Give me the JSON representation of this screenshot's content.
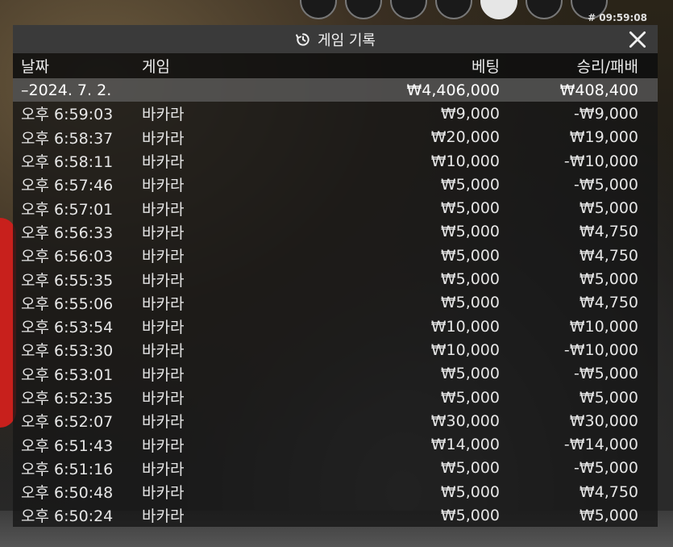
{
  "round_id": "# 09:59:08",
  "panel": {
    "title": "게임 기록",
    "columns": {
      "date": "날짜",
      "game": "게임",
      "bet": "베팅",
      "win_loss": "승리/패배"
    }
  },
  "summary": {
    "date": "–2024. 7. 2.",
    "bet": "₩4,406,000",
    "win_loss": "₩408,400"
  },
  "rows": [
    {
      "time": "오후 6:59:03",
      "game": "바카라",
      "bet": "₩9,000",
      "result": "-₩9,000"
    },
    {
      "time": "오후 6:58:37",
      "game": "바카라",
      "bet": "₩20,000",
      "result": "₩19,000"
    },
    {
      "time": "오후 6:58:11",
      "game": "바카라",
      "bet": "₩10,000",
      "result": "-₩10,000"
    },
    {
      "time": "오후 6:57:46",
      "game": "바카라",
      "bet": "₩5,000",
      "result": "-₩5,000"
    },
    {
      "time": "오후 6:57:01",
      "game": "바카라",
      "bet": "₩5,000",
      "result": "₩5,000"
    },
    {
      "time": "오후 6:56:33",
      "game": "바카라",
      "bet": "₩5,000",
      "result": "₩4,750"
    },
    {
      "time": "오후 6:56:03",
      "game": "바카라",
      "bet": "₩5,000",
      "result": "₩4,750"
    },
    {
      "time": "오후 6:55:35",
      "game": "바카라",
      "bet": "₩5,000",
      "result": "₩5,000"
    },
    {
      "time": "오후 6:55:06",
      "game": "바카라",
      "bet": "₩5,000",
      "result": "₩4,750"
    },
    {
      "time": "오후 6:53:54",
      "game": "바카라",
      "bet": "₩10,000",
      "result": "₩10,000"
    },
    {
      "time": "오후 6:53:30",
      "game": "바카라",
      "bet": "₩10,000",
      "result": "-₩10,000"
    },
    {
      "time": "오후 6:53:01",
      "game": "바카라",
      "bet": "₩5,000",
      "result": "-₩5,000"
    },
    {
      "time": "오후 6:52:35",
      "game": "바카라",
      "bet": "₩5,000",
      "result": "₩5,000"
    },
    {
      "time": "오후 6:52:07",
      "game": "바카라",
      "bet": "₩30,000",
      "result": "₩30,000"
    },
    {
      "time": "오후 6:51:43",
      "game": "바카라",
      "bet": "₩14,000",
      "result": "-₩14,000"
    },
    {
      "time": "오후 6:51:16",
      "game": "바카라",
      "bet": "₩5,000",
      "result": "-₩5,000"
    },
    {
      "time": "오후 6:50:48",
      "game": "바카라",
      "bet": "₩5,000",
      "result": "₩4,750"
    },
    {
      "time": "오후 6:50:24",
      "game": "바카라",
      "bet": "₩5,000",
      "result": "₩5,000"
    }
  ],
  "icons": {
    "header": "history-icon",
    "close": "close-icon"
  }
}
